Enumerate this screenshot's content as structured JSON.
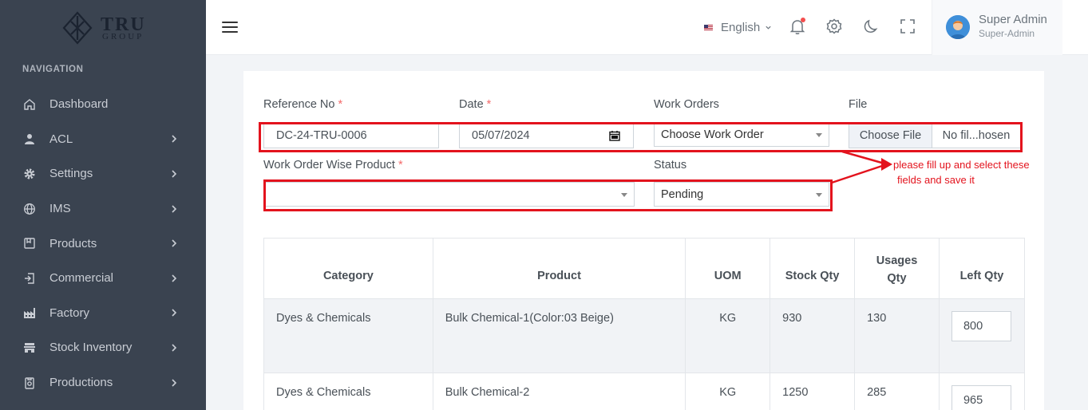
{
  "brand": {
    "name": "TRU",
    "sub": "GROUP"
  },
  "sidebar": {
    "heading": "NAVIGATION",
    "items": [
      {
        "label": "Dashboard",
        "icon": "home-icon",
        "has_children": false
      },
      {
        "label": "ACL",
        "icon": "user-icon",
        "has_children": true
      },
      {
        "label": "Settings",
        "icon": "gear-icon",
        "has_children": true
      },
      {
        "label": "IMS",
        "icon": "globe-icon",
        "has_children": true
      },
      {
        "label": "Products",
        "icon": "box-icon",
        "has_children": true
      },
      {
        "label": "Commercial",
        "icon": "sign-in-icon",
        "has_children": true
      },
      {
        "label": "Factory",
        "icon": "factory-icon",
        "has_children": true
      },
      {
        "label": "Stock Inventory",
        "icon": "store-icon",
        "has_children": true
      },
      {
        "label": "Productions",
        "icon": "clipboard-icon",
        "has_children": true
      }
    ]
  },
  "topbar": {
    "language": "English",
    "user_name": "Super Admin",
    "user_role": "Super-Admin"
  },
  "form": {
    "reference_label": "Reference No",
    "reference_value": "DC-24-TRU-0006",
    "date_label": "Date",
    "date_value": "05/07/2024",
    "work_orders_label": "Work Orders",
    "work_orders_value": "Choose Work Order",
    "file_label": "File",
    "file_button": "Choose File",
    "file_status": "No fil...hosen",
    "wo_product_label": "Work Order Wise Product",
    "wo_product_value": "",
    "status_label": "Status",
    "status_value": "Pending",
    "required_mark": "*"
  },
  "annotation": {
    "line1": "please fill  up and select these",
    "line2": "fields and save it",
    "color": "#e3131d"
  },
  "table": {
    "headers": [
      "Category",
      "Product",
      "UOM",
      "Stock Qty",
      "Usages Qty",
      "Left Qty"
    ],
    "rows": [
      {
        "category": "Dyes & Chemicals",
        "product": "Bulk Chemical-1(Color:03 Beige)",
        "uom": "KG",
        "stock": "930",
        "usage": "130",
        "left": "800"
      },
      {
        "category": "Dyes & Chemicals",
        "product": "Bulk Chemical-2",
        "uom": "KG",
        "stock": "1250",
        "usage": "285",
        "left": "965"
      }
    ]
  }
}
